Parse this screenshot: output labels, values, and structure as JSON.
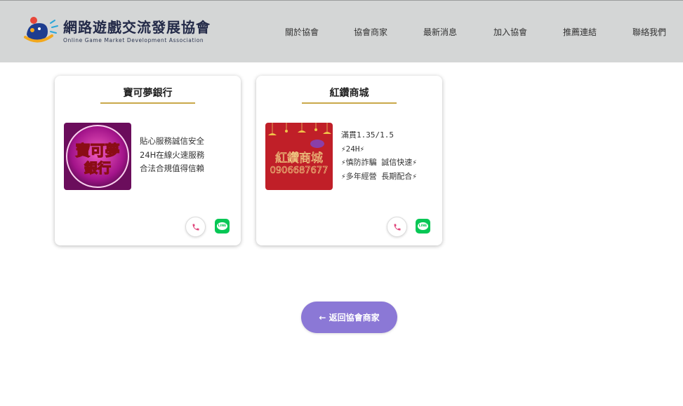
{
  "header": {
    "logo_title": "網路遊戲交流發展協會",
    "logo_subtitle": "Online Game Market Development Association",
    "nav": [
      "關於協會",
      "協會商家",
      "最新消息",
      "加入協會",
      "推薦連結",
      "聯絡我們"
    ]
  },
  "cards": [
    {
      "title": "寶可夢銀行",
      "image_text_line1": "寶可夢",
      "image_text_line2": "銀行",
      "lines": [
        "貼心服務誠信安全",
        "24H在線火速服務",
        "合法合規值得信賴"
      ]
    },
    {
      "title": "紅鑽商城",
      "image_text_line1": "紅鑽商城",
      "image_text_line2": "0906687677",
      "lines": [
        "滿貫1.35/1.5",
        "⚡24H⚡",
        "⚡慎防詐騙 誠信快速⚡",
        "⚡多年經營 長期配合⚡"
      ]
    }
  ],
  "back_button": "← 返回協會商家",
  "colors": {
    "header_bg": "#d4d6d6",
    "accent_underline": "#c9a84a",
    "button_purple": "#8b78d6",
    "line_green": "#06c755",
    "phone_pink": "#e0457b"
  },
  "icons": {
    "phone": "phone-icon",
    "line": "line-app-icon",
    "logo": "game-controller-logo-icon"
  }
}
